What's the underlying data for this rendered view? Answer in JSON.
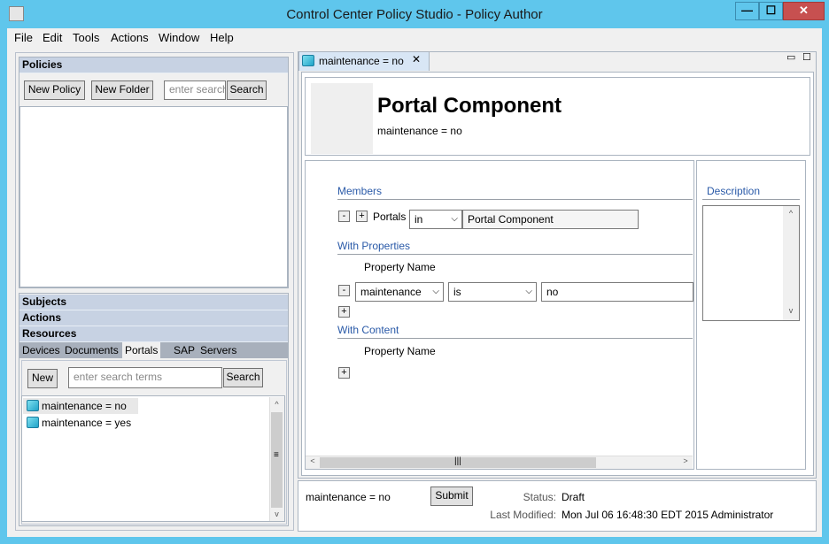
{
  "window": {
    "title": "Control Center Policy Studio - Policy Author",
    "min": "—",
    "max": "☐",
    "close": "✕"
  },
  "menu": [
    "File",
    "Edit",
    "Tools",
    "Actions",
    "Window",
    "Help"
  ],
  "policies": {
    "header": "Policies",
    "new_policy": "New Policy",
    "new_folder": "New Folder",
    "search_placeholder": "enter search",
    "search_btn": "Search"
  },
  "components": {
    "sections": [
      "Subjects",
      "Actions",
      "Resources"
    ],
    "tabs": [
      "Devices",
      "Documents",
      "Portals",
      "SAP",
      "Servers"
    ],
    "active_tab": "Portals",
    "new_btn": "New",
    "search_placeholder": "enter search terms",
    "search_btn": "Search",
    "items": [
      "maintenance = no",
      "maintenance = yes"
    ]
  },
  "editor": {
    "tab_label": "maintenance = no",
    "heading": "Portal Component",
    "subheading": "maintenance = no",
    "members_label": "Members",
    "portals_label": "Portals",
    "in_value": "in",
    "component_value": "Portal Component",
    "with_properties": "With Properties",
    "property_name": "Property Name",
    "prop_field": "maintenance",
    "prop_op": "is",
    "prop_value": "no",
    "with_content": "With Content",
    "property_name2": "Property Name",
    "description_label": "Description"
  },
  "footer": {
    "name": "maintenance = no",
    "submit": "Submit",
    "status_label": "Status:",
    "status_value": "Draft",
    "modified_label": "Last Modified:",
    "modified_value": "Mon Jul 06 16:48:30 EDT 2015 Administrator"
  }
}
